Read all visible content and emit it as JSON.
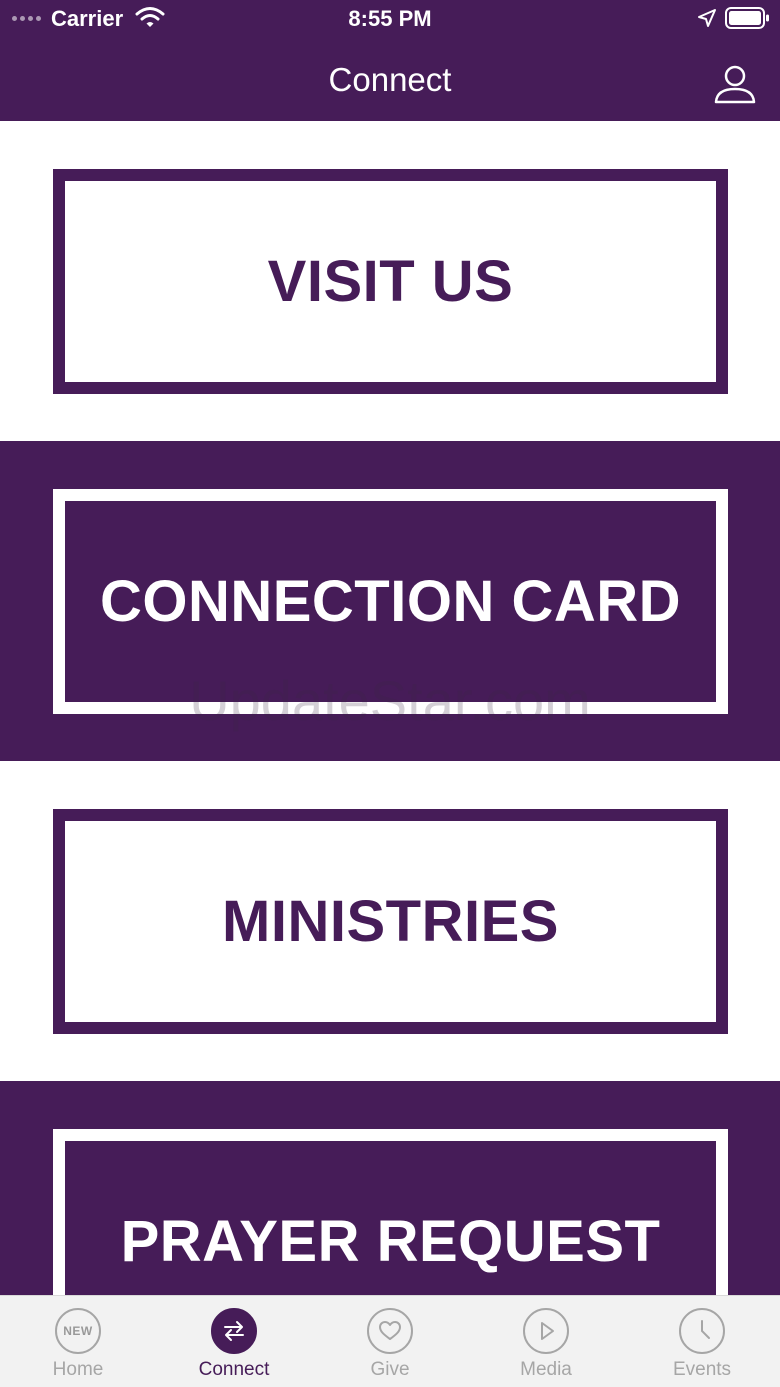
{
  "status_bar": {
    "carrier": "Carrier",
    "time": "8:55 PM"
  },
  "nav": {
    "title": "Connect"
  },
  "cards": [
    {
      "label": "VISIT US"
    },
    {
      "label": "CONNECTION CARD"
    },
    {
      "label": "MINISTRIES"
    },
    {
      "label": "PRAYER REQUEST"
    }
  ],
  "watermark": "UpdateStar.com",
  "tabbar": {
    "tabs": [
      {
        "label": "Home",
        "icon_text": "NEW",
        "icon": "new-badge-icon",
        "active": false
      },
      {
        "label": "Connect",
        "icon": "swap-arrows-icon",
        "active": true
      },
      {
        "label": "Give",
        "icon": "heart-icon",
        "active": false
      },
      {
        "label": "Media",
        "icon": "play-icon",
        "active": false
      },
      {
        "label": "Events",
        "icon": "clock-icon",
        "active": false
      }
    ]
  },
  "colors": {
    "brand_purple": "#461c58",
    "tab_inactive": "#a6a6a6",
    "tabbar_bg": "#f2f2f2"
  }
}
